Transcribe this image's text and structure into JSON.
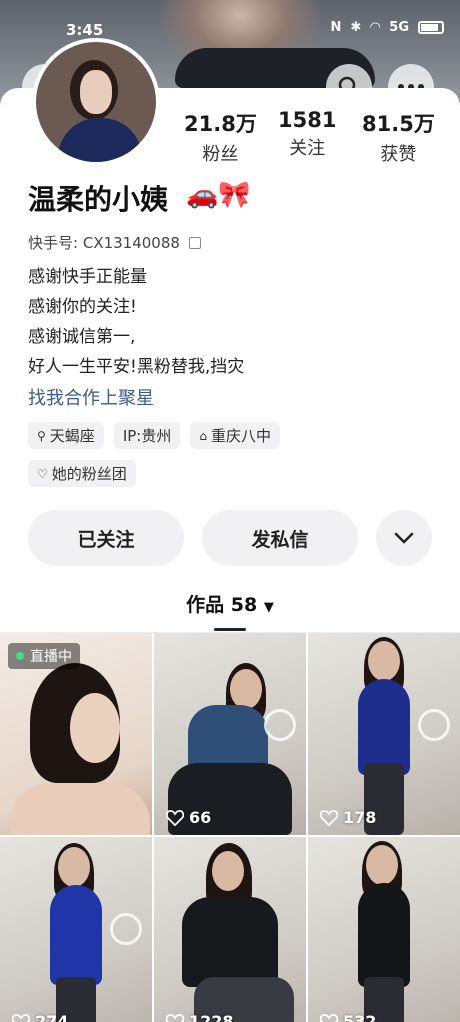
{
  "status_bar": {
    "time": "3:45",
    "signal_label": "5G"
  },
  "profile": {
    "name": "温柔的小姨",
    "name_emoji": "🚗🎀",
    "kuaishou_id_label": "快手号:",
    "kuaishou_id": "CX13140088",
    "stats": [
      {
        "value": "21.8万",
        "label": "粉丝"
      },
      {
        "value": "1581",
        "label": "关注"
      },
      {
        "value": "81.5万",
        "label": "获赞"
      }
    ],
    "bio": [
      "感谢快手正能量",
      "感谢你的关注!",
      "感谢诚信第一,",
      "好人一生平安!黑粉替我,挡灾"
    ],
    "link": "找我合作上聚星",
    "tags": [
      "天蝎座",
      "IP:贵州",
      "重庆八中"
    ],
    "fan_group": "她的粉丝团"
  },
  "actions": {
    "follow": "已关注",
    "message": "发私信"
  },
  "works_tab": {
    "label": "作品 58"
  },
  "works": [
    {
      "live": true,
      "live_label": "直播中",
      "likes": ""
    },
    {
      "live": false,
      "likes": "66"
    },
    {
      "live": false,
      "likes": "178"
    },
    {
      "live": false,
      "likes": "274"
    },
    {
      "live": false,
      "likes": "1228"
    },
    {
      "live": false,
      "likes": "532"
    }
  ],
  "colors": {
    "link": "#3c5a8a",
    "live_dot": "#3be08a",
    "button_bg": "#f1f1f3"
  }
}
